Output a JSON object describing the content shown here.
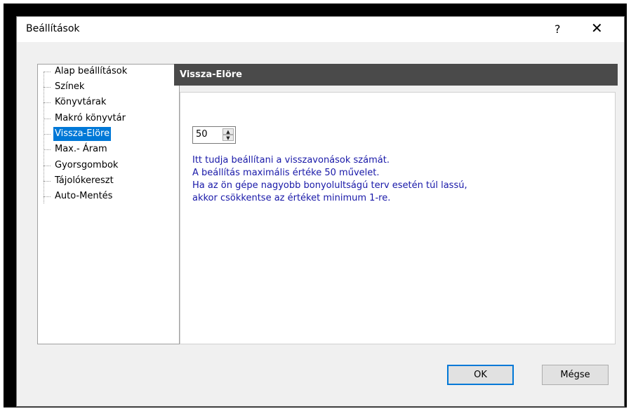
{
  "window": {
    "title": "Beállítások",
    "help_label": "?",
    "close_label": "✕"
  },
  "tree": {
    "items": [
      {
        "label": "Alap beállítások",
        "selected": false
      },
      {
        "label": "Színek",
        "selected": false
      },
      {
        "label": "Könyvtárak",
        "selected": false
      },
      {
        "label": "Makró könyvtár",
        "selected": false
      },
      {
        "label": "Vissza-Elöre",
        "selected": true
      },
      {
        "label": "Max.- Áram",
        "selected": false
      },
      {
        "label": "Gyorsgombok",
        "selected": false
      },
      {
        "label": "Tájolókereszt",
        "selected": false
      },
      {
        "label": "Auto-Mentés",
        "selected": false
      }
    ]
  },
  "panel": {
    "header": "Vissza-Elöre",
    "undo_count": "50",
    "info_lines": [
      "Itt tudja beállítani a visszavonások számát.",
      "A beállítás maximális értéke 50 művelet.",
      "Ha az ön gépe nagyobb bonyolultságú terv esetén túl lassú,",
      "akkor csökkentse az értéket minimum 1-re."
    ]
  },
  "buttons": {
    "ok": "OK",
    "cancel": "Mégse"
  },
  "colors": {
    "selection": "#0078d7",
    "header_bg": "#4a4a4a",
    "info_text": "#1818a8"
  }
}
